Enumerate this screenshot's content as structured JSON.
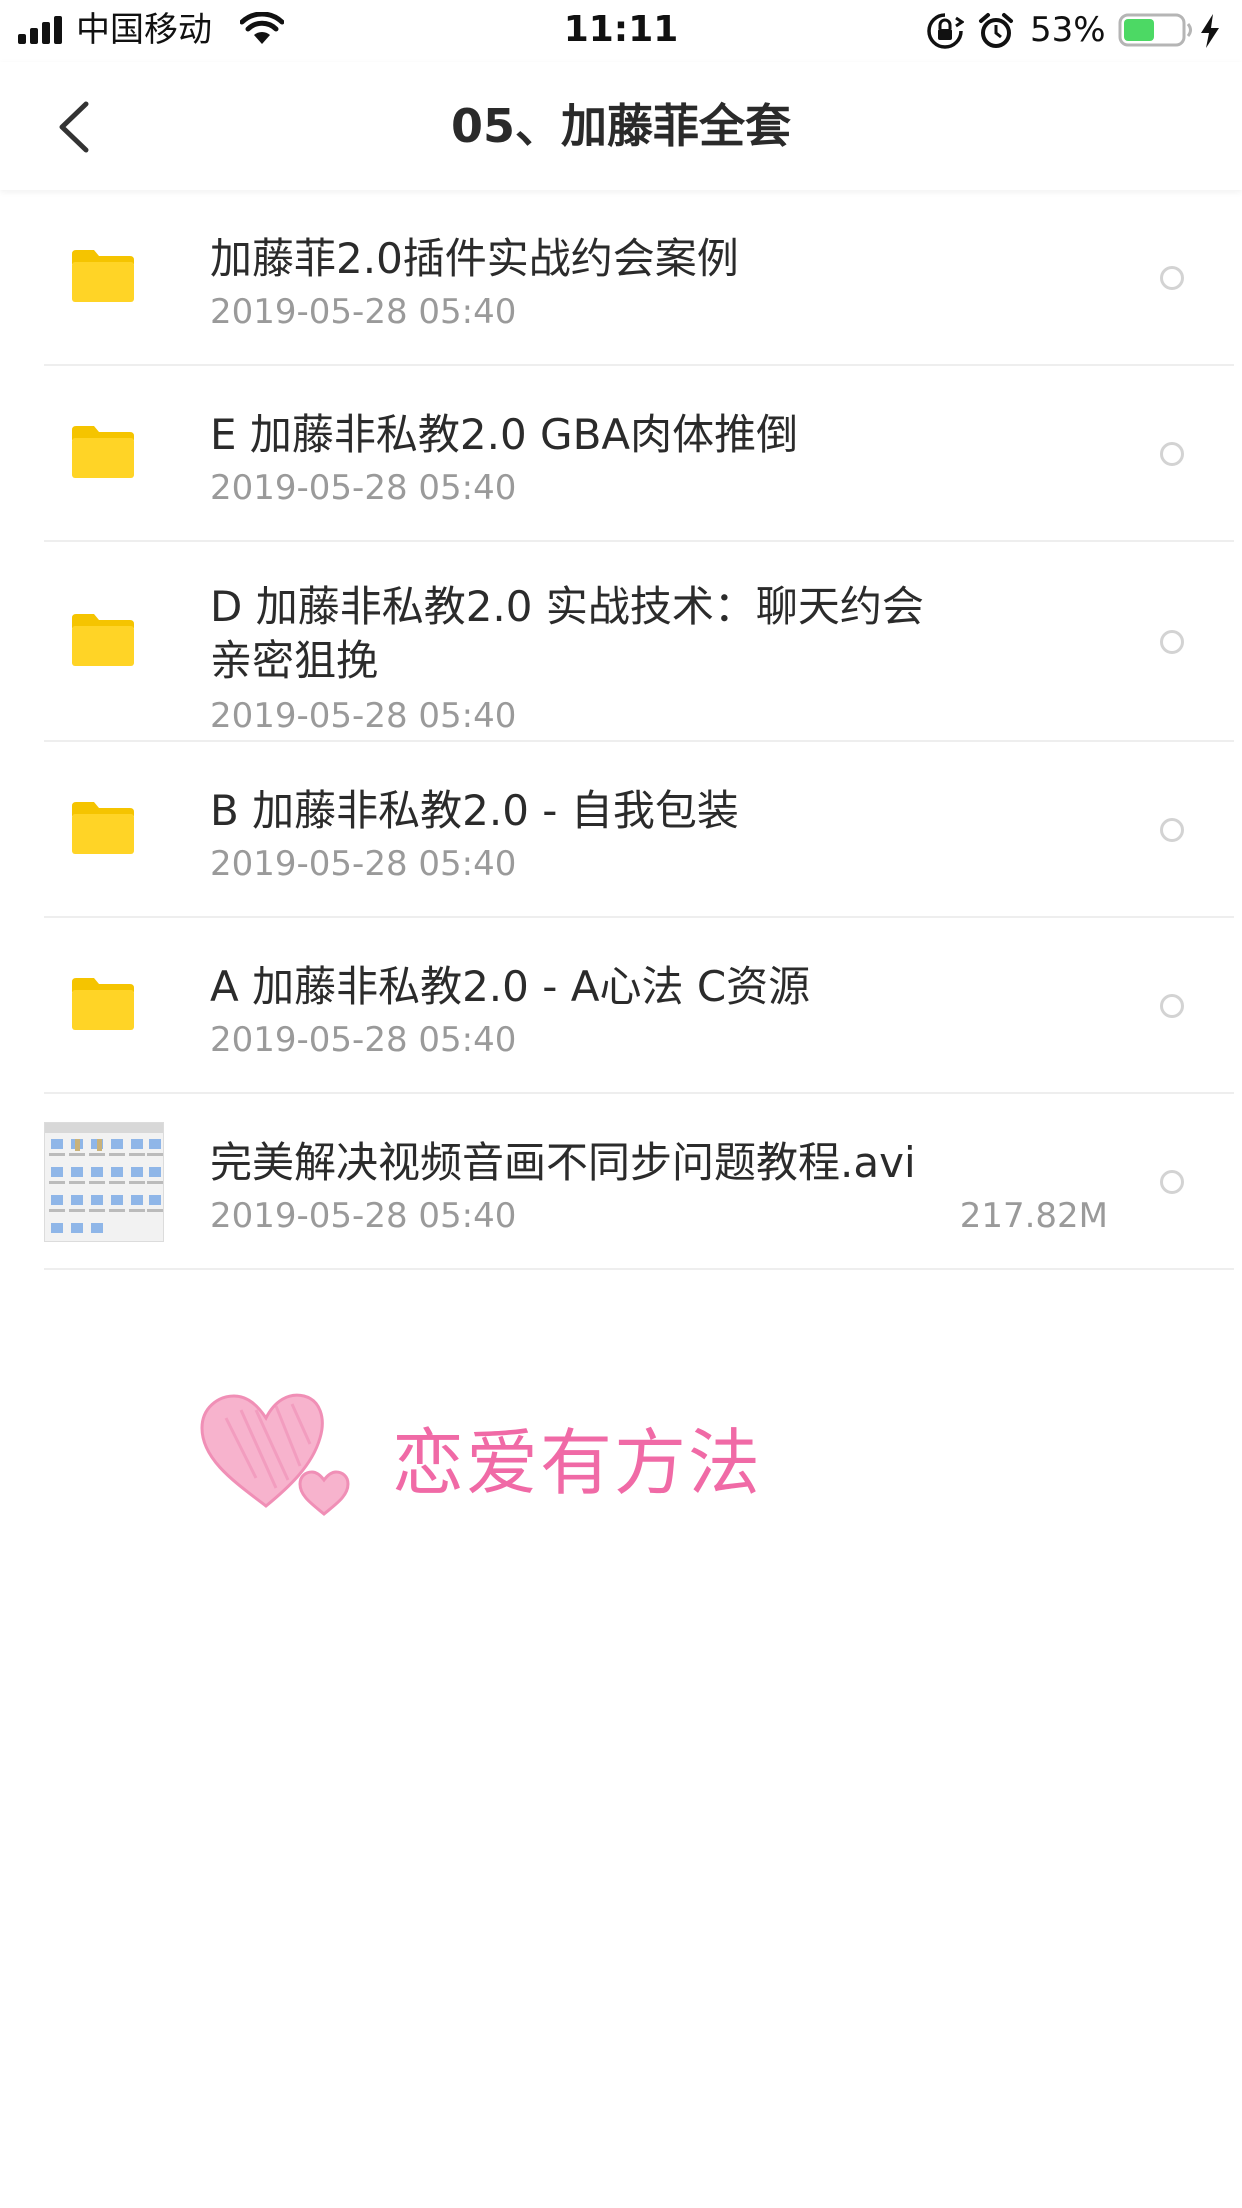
{
  "status_bar": {
    "carrier": "中国移动",
    "time": "11:11",
    "battery_percent": "53%",
    "battery_level": 0.53,
    "icons": [
      "signal-icon",
      "wifi-icon",
      "orientation-lock-icon",
      "alarm-icon",
      "battery-icon",
      "charging-icon"
    ]
  },
  "nav": {
    "title": "05、加藤菲全套",
    "back_icon": "chevron-left-icon"
  },
  "files": [
    {
      "type": "folder",
      "name": "加藤菲2.0插件实战约会案例",
      "date": "2019-05-28 05:40",
      "size": ""
    },
    {
      "type": "folder",
      "name": "E 加藤非私教2.0 GBA肉体推倒",
      "date": "2019-05-28 05:40",
      "size": ""
    },
    {
      "type": "folder",
      "name_line1": "D 加藤非私教2.0 实战技术：聊天约会",
      "name_line2": "亲密狙挽",
      "date": "2019-05-28 05:40",
      "size": ""
    },
    {
      "type": "folder",
      "name": "B 加藤非私教2.0 - 自我包装",
      "date": "2019-05-28 05:40",
      "size": ""
    },
    {
      "type": "folder",
      "name": "A 加藤非私教2.0 - A心法 C资源",
      "date": "2019-05-28 05:40",
      "size": ""
    },
    {
      "type": "video",
      "name": "完美解决视频音画不同步问题教程.avi",
      "date": "2019-05-28 05:40",
      "size": "217.82M"
    }
  ],
  "watermark": {
    "text": "恋爱有方法",
    "color": "#f06aa6"
  },
  "colors": {
    "folder": "#FFD426",
    "folder_tab": "#F5C400",
    "divider": "#eeeeee",
    "date_text": "#9a9a9a"
  }
}
